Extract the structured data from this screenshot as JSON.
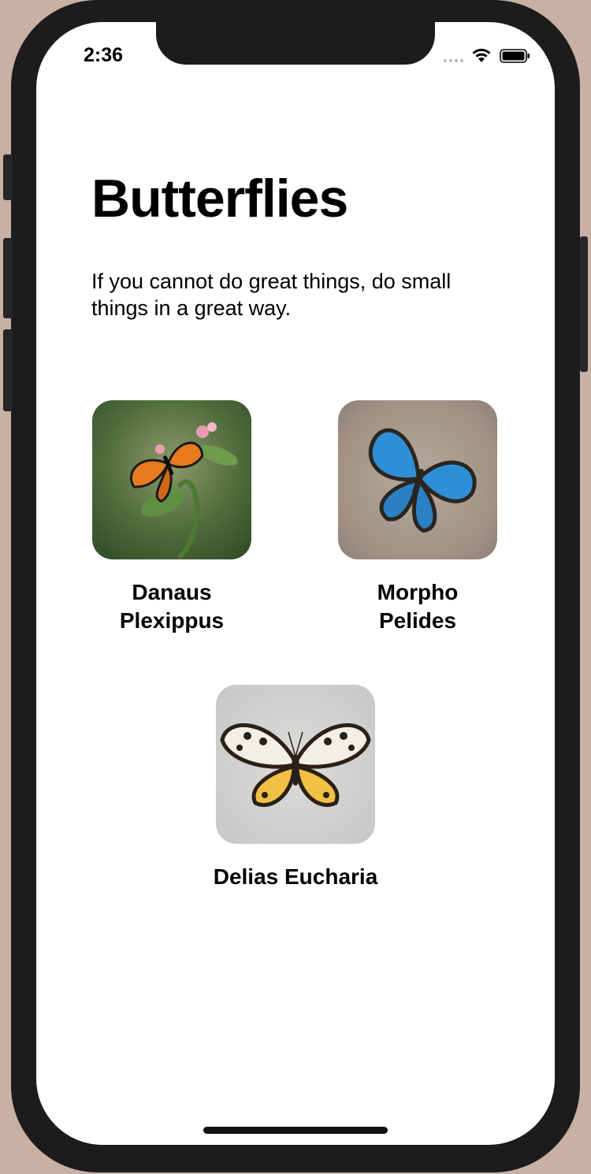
{
  "status": {
    "time": "2:36"
  },
  "page": {
    "title": "Butterflies",
    "quote": "If you cannot do great things, do small things in a great way."
  },
  "butterflies": [
    {
      "name": "Danaus Plexippus"
    },
    {
      "name": "Morpho Pelides"
    },
    {
      "name": "Delias Eucharia"
    }
  ],
  "colors": {
    "background": "#ffffff",
    "text": "#000000",
    "phone_frame": "#1c1c1c"
  }
}
